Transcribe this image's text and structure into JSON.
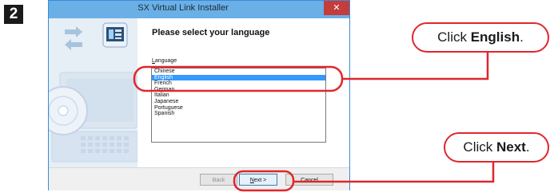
{
  "step_number": "2",
  "window": {
    "title": "SX Virtual Link Installer",
    "close_icon": "close-icon"
  },
  "page": {
    "heading": "Please select your language",
    "language_label_first": "L",
    "language_label_rest": "anguage"
  },
  "languages": [
    "Chinese",
    "English",
    "French",
    "German",
    "Italian",
    "Japanese",
    "Portuguese",
    "Spanish"
  ],
  "selected_language": "English",
  "buttons": {
    "back": "Back",
    "next_first": "N",
    "next_rest": "ext >",
    "cancel": "Cancel"
  },
  "callouts": {
    "english_prefix": "Click ",
    "english_bold": "English",
    "english_suffix": ".",
    "next_prefix": "Click ",
    "next_bold": "Next",
    "next_suffix": "."
  },
  "colors": {
    "highlight": "#e0262d",
    "selection": "#3399ff",
    "titlebar": "#6ab0e6",
    "close": "#c43c3c"
  }
}
